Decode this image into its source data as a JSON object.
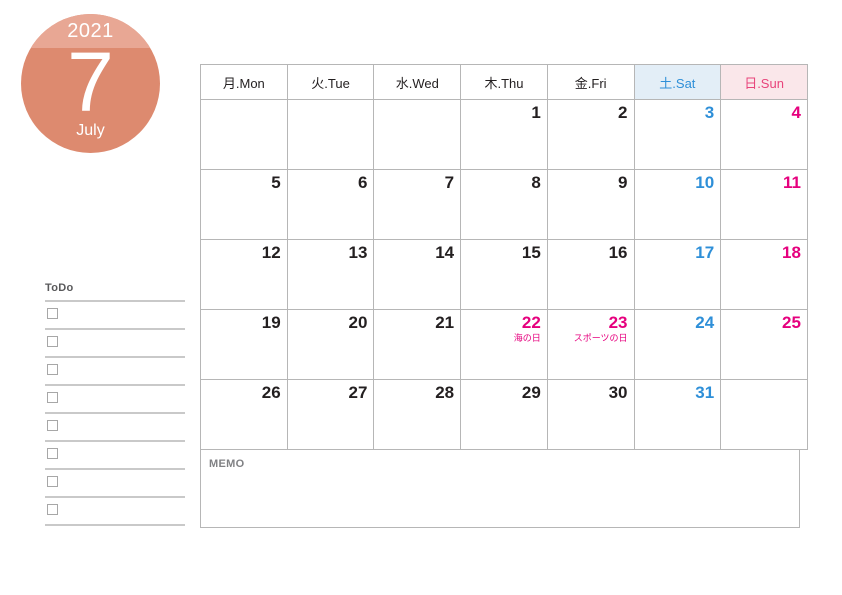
{
  "month_badge": {
    "year": "2021",
    "month_number": "7",
    "month_name": "July",
    "cap_color": "#e8a794",
    "body_color": "#dd8a6f",
    "text_color": "#ffffff"
  },
  "calendar": {
    "weekday_headers": [
      {
        "label": "月.Mon",
        "kind": "weekday"
      },
      {
        "label": "火.Tue",
        "kind": "weekday"
      },
      {
        "label": "水.Wed",
        "kind": "weekday"
      },
      {
        "label": "木.Thu",
        "kind": "weekday"
      },
      {
        "label": "金.Fri",
        "kind": "weekday"
      },
      {
        "label": "土.Sat",
        "kind": "sat"
      },
      {
        "label": "日.Sun",
        "kind": "sun"
      }
    ],
    "weeks": [
      [
        {
          "day": ""
        },
        {
          "day": ""
        },
        {
          "day": ""
        },
        {
          "day": "1"
        },
        {
          "day": "2"
        },
        {
          "day": "3",
          "kind": "sat"
        },
        {
          "day": "4",
          "kind": "sun"
        }
      ],
      [
        {
          "day": "5"
        },
        {
          "day": "6"
        },
        {
          "day": "7"
        },
        {
          "day": "8"
        },
        {
          "day": "9"
        },
        {
          "day": "10",
          "kind": "sat"
        },
        {
          "day": "11",
          "kind": "sun"
        }
      ],
      [
        {
          "day": "12"
        },
        {
          "day": "13"
        },
        {
          "day": "14"
        },
        {
          "day": "15"
        },
        {
          "day": "16"
        },
        {
          "day": "17",
          "kind": "sat"
        },
        {
          "day": "18",
          "kind": "sun"
        }
      ],
      [
        {
          "day": "19"
        },
        {
          "day": "20"
        },
        {
          "day": "21"
        },
        {
          "day": "22",
          "kind": "holiday",
          "event": "海の日"
        },
        {
          "day": "23",
          "kind": "holiday",
          "event": "スポーツの日"
        },
        {
          "day": "24",
          "kind": "sat"
        },
        {
          "day": "25",
          "kind": "sun"
        }
      ],
      [
        {
          "day": "26"
        },
        {
          "day": "27"
        },
        {
          "day": "28"
        },
        {
          "day": "29"
        },
        {
          "day": "30"
        },
        {
          "day": "31",
          "kind": "sat"
        },
        {
          "day": ""
        }
      ]
    ],
    "colors": {
      "sat_text": "#2e8fd8",
      "sun_text": "#e6007e",
      "sat_header_bg": "#e3eef7",
      "sun_header_bg": "#fae7ea",
      "grid_line": "#b6b6b6",
      "weekday_text": "#231f20"
    }
  },
  "todo": {
    "title": "ToDo",
    "row_count": 8,
    "rows": [
      {
        "checked": false,
        "text": ""
      },
      {
        "checked": false,
        "text": ""
      },
      {
        "checked": false,
        "text": ""
      },
      {
        "checked": false,
        "text": ""
      },
      {
        "checked": false,
        "text": ""
      },
      {
        "checked": false,
        "text": ""
      },
      {
        "checked": false,
        "text": ""
      },
      {
        "checked": false,
        "text": ""
      }
    ]
  },
  "memo": {
    "label": "MEMO",
    "text": ""
  }
}
